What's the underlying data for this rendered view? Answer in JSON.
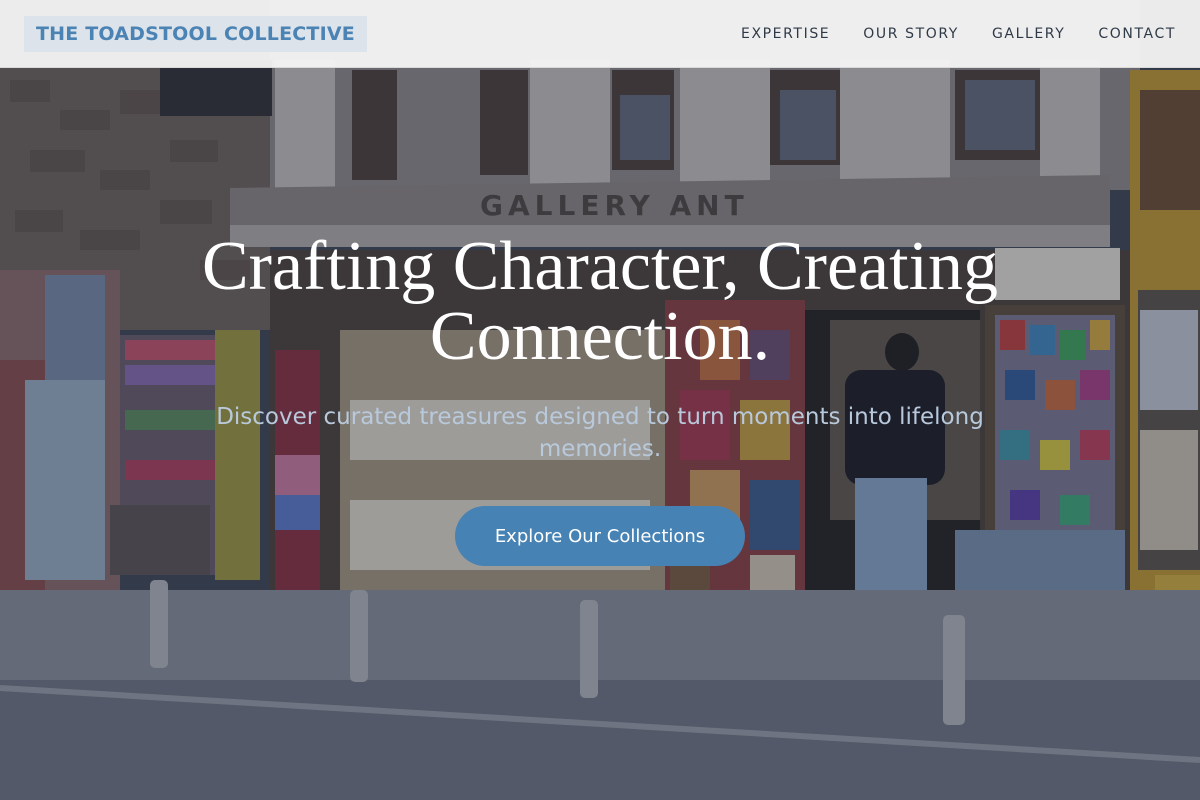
{
  "header": {
    "logo_text": "THE TOADSTOOL COLLECTIVE",
    "nav": [
      {
        "label": "EXPERTISE"
      },
      {
        "label": "OUR STORY"
      },
      {
        "label": "GALLERY"
      },
      {
        "label": "CONTACT"
      }
    ]
  },
  "hero": {
    "title_line1": "Crafting Character, Creating",
    "title_line2": "Connection.",
    "subtitle_line1": "Discover curated treasures designed to turn moments into lifelong",
    "subtitle_line2": "memories.",
    "cta_label": "Explore Our Collections",
    "storefront_sign": "GALLERY ANT"
  },
  "colors": {
    "accent": "#4682b4",
    "logo_text": "#4a83b4",
    "logo_bg": "#dde3ea",
    "header_bg": "#f6f6f6",
    "nav_text": "#2f3a48",
    "subtitle": "#b9c9dc"
  }
}
